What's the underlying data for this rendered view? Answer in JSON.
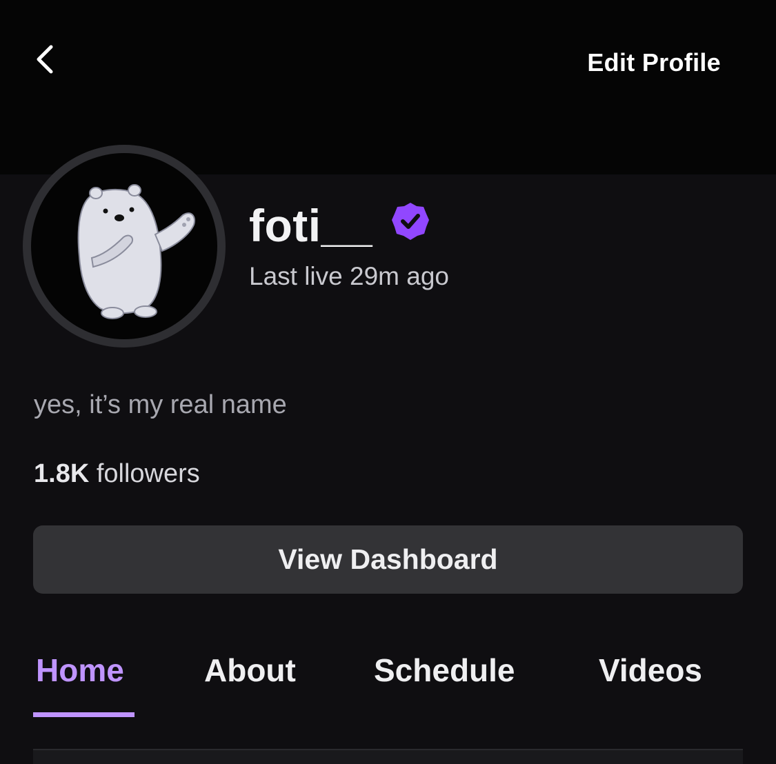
{
  "header": {
    "back_icon": "chevron-left-icon",
    "edit_profile_label": "Edit Profile"
  },
  "profile": {
    "avatar_icon": "polar-bear-avatar",
    "username": "foti__",
    "verified_icon": "verified-badge-icon",
    "last_live": "Last live 29m ago",
    "bio": "yes, it’s my real name",
    "followers_count": "1.8K",
    "followers_label": " followers"
  },
  "actions": {
    "dashboard_label": "View Dashboard"
  },
  "tabs": [
    {
      "label": "Home",
      "active": true
    },
    {
      "label": "About",
      "active": false
    },
    {
      "label": "Schedule",
      "active": false
    },
    {
      "label": "Videos",
      "active": false
    }
  ],
  "colors": {
    "accent": "#bf94ff",
    "verified": "#9147ff",
    "background": "#0f0e11",
    "button": "#333336"
  }
}
